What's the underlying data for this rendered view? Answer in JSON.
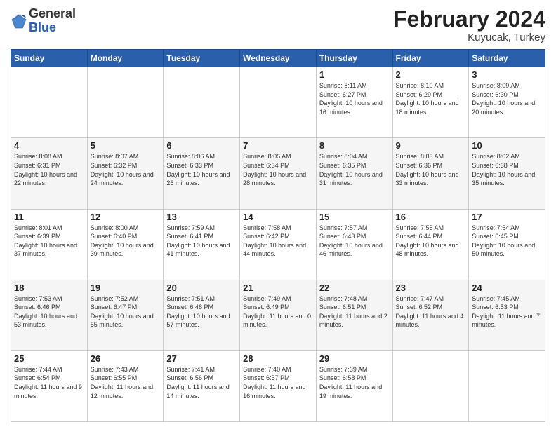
{
  "header": {
    "logo_general": "General",
    "logo_blue": "Blue",
    "title": "February 2024",
    "location": "Kuyucak, Turkey"
  },
  "weekdays": [
    "Sunday",
    "Monday",
    "Tuesday",
    "Wednesday",
    "Thursday",
    "Friday",
    "Saturday"
  ],
  "weeks": [
    [
      {
        "day": "",
        "info": ""
      },
      {
        "day": "",
        "info": ""
      },
      {
        "day": "",
        "info": ""
      },
      {
        "day": "",
        "info": ""
      },
      {
        "day": "1",
        "info": "Sunrise: 8:11 AM\nSunset: 6:27 PM\nDaylight: 10 hours\nand 16 minutes."
      },
      {
        "day": "2",
        "info": "Sunrise: 8:10 AM\nSunset: 6:29 PM\nDaylight: 10 hours\nand 18 minutes."
      },
      {
        "day": "3",
        "info": "Sunrise: 8:09 AM\nSunset: 6:30 PM\nDaylight: 10 hours\nand 20 minutes."
      }
    ],
    [
      {
        "day": "4",
        "info": "Sunrise: 8:08 AM\nSunset: 6:31 PM\nDaylight: 10 hours\nand 22 minutes."
      },
      {
        "day": "5",
        "info": "Sunrise: 8:07 AM\nSunset: 6:32 PM\nDaylight: 10 hours\nand 24 minutes."
      },
      {
        "day": "6",
        "info": "Sunrise: 8:06 AM\nSunset: 6:33 PM\nDaylight: 10 hours\nand 26 minutes."
      },
      {
        "day": "7",
        "info": "Sunrise: 8:05 AM\nSunset: 6:34 PM\nDaylight: 10 hours\nand 28 minutes."
      },
      {
        "day": "8",
        "info": "Sunrise: 8:04 AM\nSunset: 6:35 PM\nDaylight: 10 hours\nand 31 minutes."
      },
      {
        "day": "9",
        "info": "Sunrise: 8:03 AM\nSunset: 6:36 PM\nDaylight: 10 hours\nand 33 minutes."
      },
      {
        "day": "10",
        "info": "Sunrise: 8:02 AM\nSunset: 6:38 PM\nDaylight: 10 hours\nand 35 minutes."
      }
    ],
    [
      {
        "day": "11",
        "info": "Sunrise: 8:01 AM\nSunset: 6:39 PM\nDaylight: 10 hours\nand 37 minutes."
      },
      {
        "day": "12",
        "info": "Sunrise: 8:00 AM\nSunset: 6:40 PM\nDaylight: 10 hours\nand 39 minutes."
      },
      {
        "day": "13",
        "info": "Sunrise: 7:59 AM\nSunset: 6:41 PM\nDaylight: 10 hours\nand 41 minutes."
      },
      {
        "day": "14",
        "info": "Sunrise: 7:58 AM\nSunset: 6:42 PM\nDaylight: 10 hours\nand 44 minutes."
      },
      {
        "day": "15",
        "info": "Sunrise: 7:57 AM\nSunset: 6:43 PM\nDaylight: 10 hours\nand 46 minutes."
      },
      {
        "day": "16",
        "info": "Sunrise: 7:55 AM\nSunset: 6:44 PM\nDaylight: 10 hours\nand 48 minutes."
      },
      {
        "day": "17",
        "info": "Sunrise: 7:54 AM\nSunset: 6:45 PM\nDaylight: 10 hours\nand 50 minutes."
      }
    ],
    [
      {
        "day": "18",
        "info": "Sunrise: 7:53 AM\nSunset: 6:46 PM\nDaylight: 10 hours\nand 53 minutes."
      },
      {
        "day": "19",
        "info": "Sunrise: 7:52 AM\nSunset: 6:47 PM\nDaylight: 10 hours\nand 55 minutes."
      },
      {
        "day": "20",
        "info": "Sunrise: 7:51 AM\nSunset: 6:48 PM\nDaylight: 10 hours\nand 57 minutes."
      },
      {
        "day": "21",
        "info": "Sunrise: 7:49 AM\nSunset: 6:49 PM\nDaylight: 11 hours\nand 0 minutes."
      },
      {
        "day": "22",
        "info": "Sunrise: 7:48 AM\nSunset: 6:51 PM\nDaylight: 11 hours\nand 2 minutes."
      },
      {
        "day": "23",
        "info": "Sunrise: 7:47 AM\nSunset: 6:52 PM\nDaylight: 11 hours\nand 4 minutes."
      },
      {
        "day": "24",
        "info": "Sunrise: 7:45 AM\nSunset: 6:53 PM\nDaylight: 11 hours\nand 7 minutes."
      }
    ],
    [
      {
        "day": "25",
        "info": "Sunrise: 7:44 AM\nSunset: 6:54 PM\nDaylight: 11 hours\nand 9 minutes."
      },
      {
        "day": "26",
        "info": "Sunrise: 7:43 AM\nSunset: 6:55 PM\nDaylight: 11 hours\nand 12 minutes."
      },
      {
        "day": "27",
        "info": "Sunrise: 7:41 AM\nSunset: 6:56 PM\nDaylight: 11 hours\nand 14 minutes."
      },
      {
        "day": "28",
        "info": "Sunrise: 7:40 AM\nSunset: 6:57 PM\nDaylight: 11 hours\nand 16 minutes."
      },
      {
        "day": "29",
        "info": "Sunrise: 7:39 AM\nSunset: 6:58 PM\nDaylight: 11 hours\nand 19 minutes."
      },
      {
        "day": "",
        "info": ""
      },
      {
        "day": "",
        "info": ""
      }
    ]
  ]
}
